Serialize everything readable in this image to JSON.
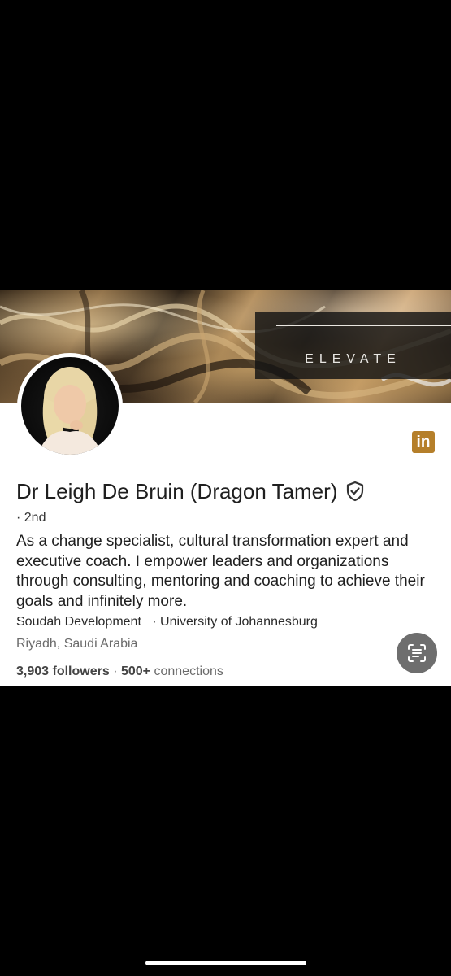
{
  "banner": {
    "text": "ELEVATE"
  },
  "profile": {
    "name": "Dr Leigh De Bruin (Dragon Tamer)",
    "degree": "· 2nd",
    "headline": "As a change specialist, cultural transformation expert and executive coach. I empower leaders and organizations through consulting, mentoring and coaching to achieve their goals and infinitely more.",
    "company": "Soudah Development",
    "separator": "·",
    "school": "University of Johannesburg",
    "location": "Riyadh, Saudi Arabia",
    "followers_count": "3,903",
    "followers_label": "followers",
    "stats_separator": "·",
    "connections_count": "500+",
    "connections_label": "connections"
  },
  "linkedin_logo": {
    "text": "in"
  },
  "colors": {
    "linkedin_badge": "#b57f2a",
    "card_bg": "#ffffff",
    "page_bg": "#000000",
    "scan_button": "#6e6e6e"
  },
  "icons": {
    "verified": "shield-check-icon",
    "scan": "text-scan-icon",
    "linkedin": "linkedin-icon"
  }
}
